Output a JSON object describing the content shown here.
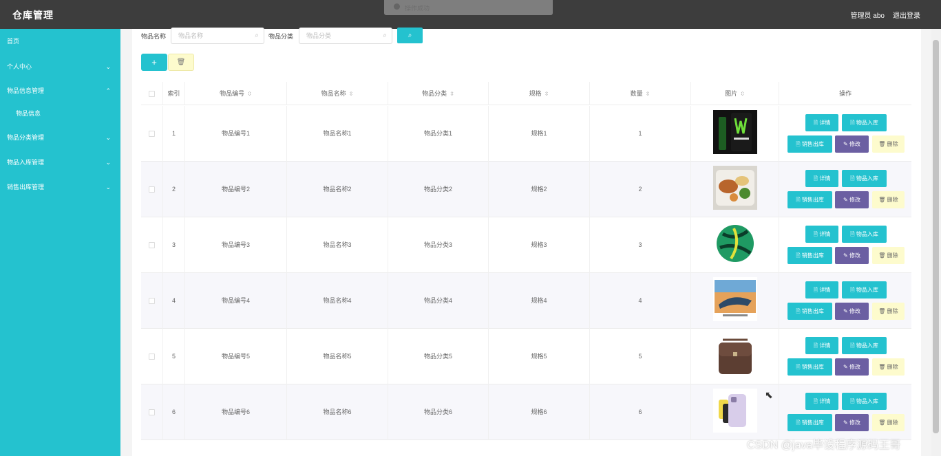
{
  "app": {
    "title": "仓库管理"
  },
  "header": {
    "user_label": "管理员 abo",
    "logout_label": "退出登录"
  },
  "toast": {
    "text": "操作成功"
  },
  "sidebar": {
    "items": [
      {
        "label": "首页",
        "chevron": ""
      },
      {
        "label": "个人中心",
        "chevron": "⌄"
      },
      {
        "label": "物品信息管理",
        "chevron": "⌃"
      },
      {
        "label": "物品信息",
        "chevron": ""
      },
      {
        "label": "物品分类管理",
        "chevron": "⌄"
      },
      {
        "label": "物品入库管理",
        "chevron": "⌄"
      },
      {
        "label": "销售出库管理",
        "chevron": "⌄"
      }
    ]
  },
  "search": {
    "name_label": "物品名称",
    "name_placeholder": "物品名称",
    "category_label": "物品分类",
    "category_placeholder": "物品分类",
    "search_icon": "search-icon"
  },
  "toolbar": {
    "add_label": "+",
    "delete_icon": "🗑"
  },
  "table": {
    "columns": [
      "索引",
      "物品编号",
      "物品名称",
      "物品分类",
      "规格",
      "数量",
      "图片",
      "操作"
    ],
    "sort_glyph": "⇳",
    "rows": [
      {
        "index": "1",
        "code": "物品编号1",
        "name": "物品名称1",
        "category": "物品分类1",
        "spec": "规格1",
        "qty": "1",
        "image": "energy-drink-can"
      },
      {
        "index": "2",
        "code": "物品编号2",
        "name": "物品名称2",
        "category": "物品分类2",
        "spec": "规格2",
        "qty": "2",
        "image": "food-box"
      },
      {
        "index": "3",
        "code": "物品编号3",
        "name": "物品名称3",
        "category": "物品分类3",
        "spec": "规格3",
        "qty": "3",
        "image": "green-ball"
      },
      {
        "index": "4",
        "code": "物品编号4",
        "name": "物品名称4",
        "category": "物品分类4",
        "spec": "规格4",
        "qty": "4",
        "image": "tv-screen"
      },
      {
        "index": "5",
        "code": "物品编号5",
        "name": "物品名称5",
        "category": "物品分类5",
        "spec": "规格5",
        "qty": "5",
        "image": "leather-bag"
      },
      {
        "index": "6",
        "code": "物品编号6",
        "name": "物品名称6",
        "category": "物品分类6",
        "spec": "规格6",
        "qty": "6",
        "image": "phone-colors"
      }
    ],
    "actions": {
      "detail": "🗎 详情",
      "stock_in": "🗎 物品入库",
      "sale_out": "🗎 销售出库",
      "edit": "✎ 修改",
      "delete": "🗑 删除"
    }
  },
  "watermark": "CSDN @java毕设程序源码王哥"
}
